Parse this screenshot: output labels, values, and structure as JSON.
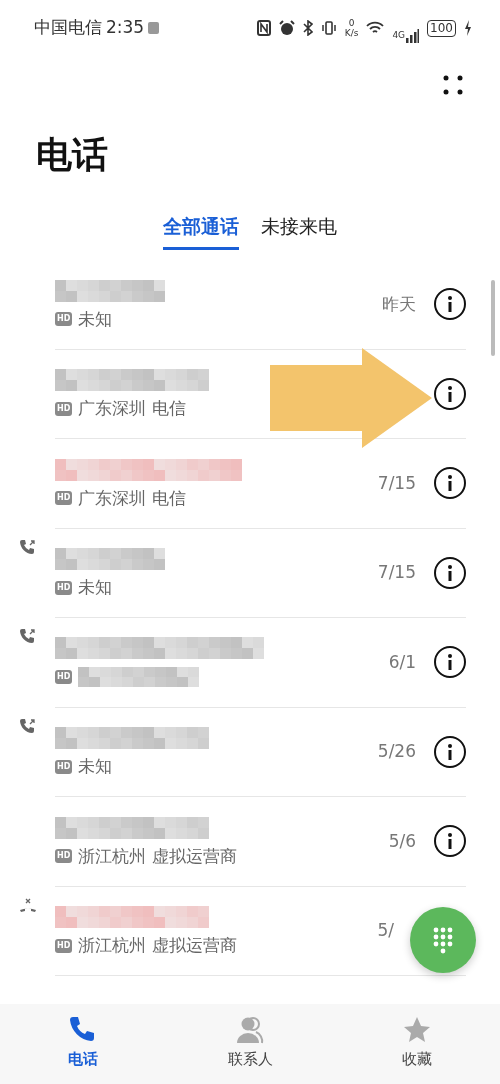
{
  "status_bar": {
    "carrier": "中国电信",
    "time": "2:35",
    "speed_value": "0",
    "speed_unit": "K/s",
    "network": "4G",
    "battery": "100"
  },
  "title": "电话",
  "tabs": [
    {
      "label": "全部通话",
      "selected": true
    },
    {
      "label": "未接来电",
      "selected": false
    }
  ],
  "calls": [
    {
      "kind": "none",
      "missed": false,
      "info_visible": true,
      "badge": "HD",
      "location": "未知",
      "date": "昨天"
    },
    {
      "kind": "none",
      "missed": false,
      "info_visible": true,
      "badge": "HD",
      "location": "广东深圳 电信"
    },
    {
      "kind": "none",
      "missed": true,
      "info_visible": true,
      "badge": "HD",
      "location": "广东深圳 电信",
      "date": "7/15"
    },
    {
      "kind": "outgoing",
      "missed": false,
      "info_visible": true,
      "badge": "HD",
      "location": "未知",
      "date": "7/15"
    },
    {
      "kind": "outgoing",
      "missed": false,
      "info_visible": true,
      "badge": "HD",
      "date": "6/1"
    },
    {
      "kind": "outgoing",
      "missed": false,
      "info_visible": true,
      "badge": "HD",
      "location": "未知",
      "date": "5/26"
    },
    {
      "kind": "none",
      "missed": false,
      "info_visible": true,
      "badge": "HD",
      "location": "浙江杭州 虚拟运营商",
      "date": "5/6"
    },
    {
      "kind": "rejected",
      "missed": true,
      "info_visible": false,
      "badge": "HD",
      "location": "浙江杭州 虚拟运营商",
      "date": "5/"
    }
  ],
  "bottom_nav": [
    {
      "label": "电话",
      "selected": true
    },
    {
      "label": "联系人",
      "selected": false
    },
    {
      "label": "收藏",
      "selected": false
    }
  ]
}
